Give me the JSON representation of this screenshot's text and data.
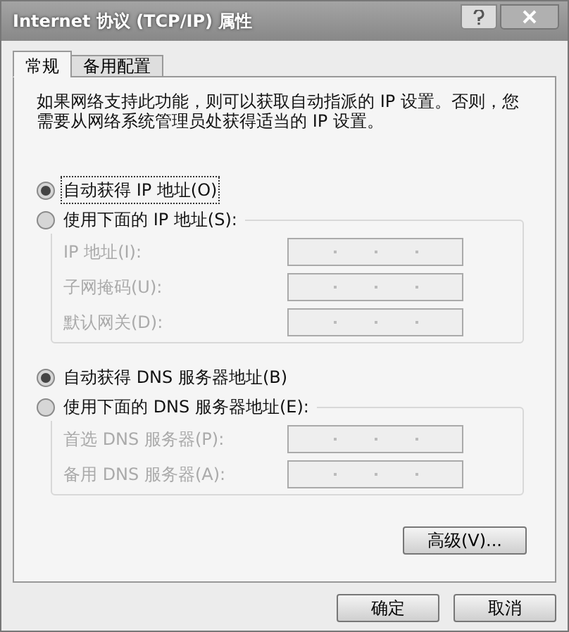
{
  "window": {
    "title": "Internet 协议 (TCP/IP) 属性"
  },
  "tabs": [
    {
      "label": "常规",
      "selected": true
    },
    {
      "label": "备用配置",
      "selected": false
    }
  ],
  "intro": "如果网络支持此功能，则可以获取自动指派的 IP 设置。否则，您需要从网络系统管理员处获得适当的 IP 设置。",
  "sections": [
    {
      "options": [
        {
          "label": "自动获得 IP 地址(O)",
          "selected": true,
          "focused": true
        },
        {
          "label": "使用下面的 IP 地址(S):",
          "selected": false,
          "focused": false
        }
      ],
      "fields": [
        {
          "label": "IP 地址(I):",
          "disabled": true
        },
        {
          "label": "子网掩码(U):",
          "disabled": true
        },
        {
          "label": "默认网关(D):",
          "disabled": true
        }
      ]
    },
    {
      "options": [
        {
          "label": "自动获得 DNS 服务器地址(B)",
          "selected": true,
          "focused": false
        },
        {
          "label": "使用下面的 DNS 服务器地址(E):",
          "selected": false,
          "focused": false
        }
      ],
      "fields": [
        {
          "label": "首选 DNS 服务器(P):",
          "disabled": true
        },
        {
          "label": "备用 DNS 服务器(A):",
          "disabled": true
        }
      ]
    }
  ],
  "advanced_button": "高级(V)...",
  "buttons": [
    "确定",
    "取消"
  ]
}
